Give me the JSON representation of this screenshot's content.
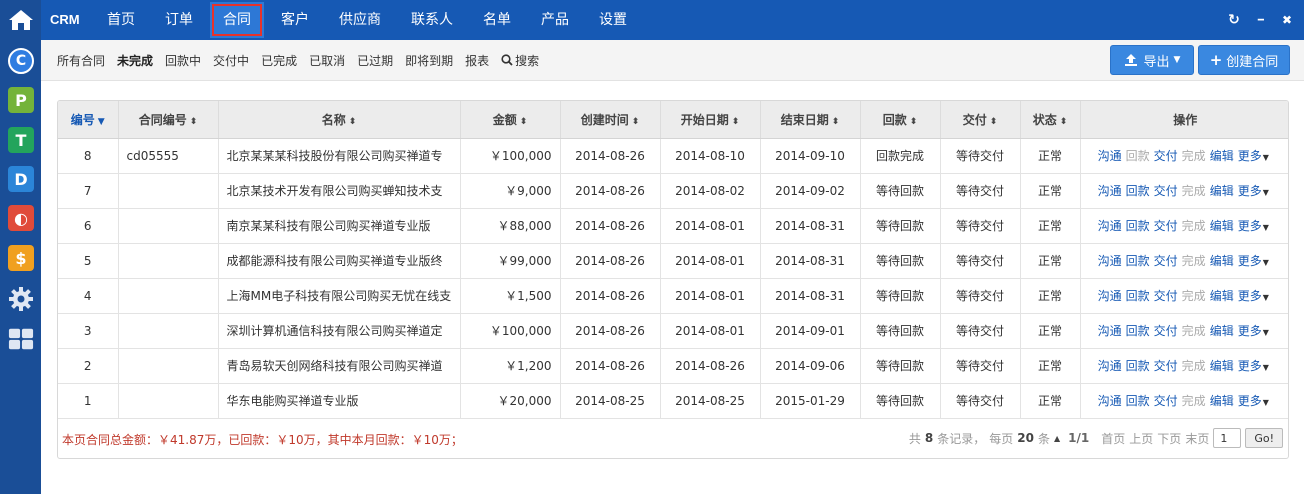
{
  "app": {
    "brand": "CRM"
  },
  "nav": [
    "首页",
    "订单",
    "合同",
    "客户",
    "供应商",
    "联系人",
    "名单",
    "产品",
    "设置"
  ],
  "nav_active": 2,
  "window_controls": {
    "refresh": "↻",
    "minimize": "━",
    "close": "✖"
  },
  "sidebar_letters": [
    "C",
    "P",
    "T",
    "D",
    "◐",
    "$"
  ],
  "subnav": [
    "所有合同",
    "未完成",
    "回款中",
    "交付中",
    "已完成",
    "已取消",
    "已过期",
    "即将到期",
    "报表",
    "搜索"
  ],
  "subnav_bold": 1,
  "buttons": {
    "export": "导出",
    "create": "创建合同"
  },
  "table": {
    "headers": [
      "编号",
      "合同编号",
      "名称",
      "金额",
      "创建时间",
      "开始日期",
      "结束日期",
      "回款",
      "交付",
      "状态",
      "操作"
    ],
    "rows": [
      [
        "8",
        "cd05555",
        "北京某某某科技股份有限公司购买禅道专",
        "￥100,000",
        "2014-08-26",
        "2014-08-10",
        "2014-09-10",
        "回款完成",
        "等待交付",
        "正常"
      ],
      [
        "7",
        "",
        "北京某技术开发有限公司购买蝉知技术支",
        "￥9,000",
        "2014-08-26",
        "2014-08-02",
        "2014-09-02",
        "等待回款",
        "等待交付",
        "正常"
      ],
      [
        "6",
        "",
        "南京某某科技有限公司购买禅道专业版",
        "￥88,000",
        "2014-08-26",
        "2014-08-01",
        "2014-08-31",
        "等待回款",
        "等待交付",
        "正常"
      ],
      [
        "5",
        "",
        "成都能源科技有限公司购买禅道专业版终",
        "￥99,000",
        "2014-08-26",
        "2014-08-01",
        "2014-08-31",
        "等待回款",
        "等待交付",
        "正常"
      ],
      [
        "4",
        "",
        "上海MM电子科技有限公司购买无忧在线支",
        "￥1,500",
        "2014-08-26",
        "2014-08-01",
        "2014-08-31",
        "等待回款",
        "等待交付",
        "正常"
      ],
      [
        "3",
        "",
        "深圳计算机通信科技有限公司购买禅道定",
        "￥100,000",
        "2014-08-26",
        "2014-08-01",
        "2014-09-01",
        "等待回款",
        "等待交付",
        "正常"
      ],
      [
        "2",
        "",
        "青岛易软天创网络科技有限公司购买禅道",
        "￥1,200",
        "2014-08-26",
        "2014-08-26",
        "2014-09-06",
        "等待回款",
        "等待交付",
        "正常"
      ],
      [
        "1",
        "",
        "华东电能购买禅道专业版",
        "￥20,000",
        "2014-08-25",
        "2014-08-25",
        "2015-01-29",
        "等待回款",
        "等待交付",
        "正常"
      ]
    ],
    "actions": [
      "沟通",
      "回款",
      "交付",
      "完成",
      "编辑",
      "更多"
    ],
    "first_row_dim": [
      1,
      3
    ]
  },
  "summary": "本页合同总金额：￥41.87万，已回款：￥10万，其中本月回款：￥10万；",
  "pager": {
    "total_prefix": "共",
    "total": "8",
    "total_suffix": "条记录，",
    "per_page_prefix": "每页",
    "per_page": "20",
    "per_page_suffix": "条",
    "page_info": "1/1",
    "first": "首页",
    "prev": "上页",
    "next": "下页",
    "last": "末页",
    "page_value": "1",
    "go": "Go!"
  }
}
